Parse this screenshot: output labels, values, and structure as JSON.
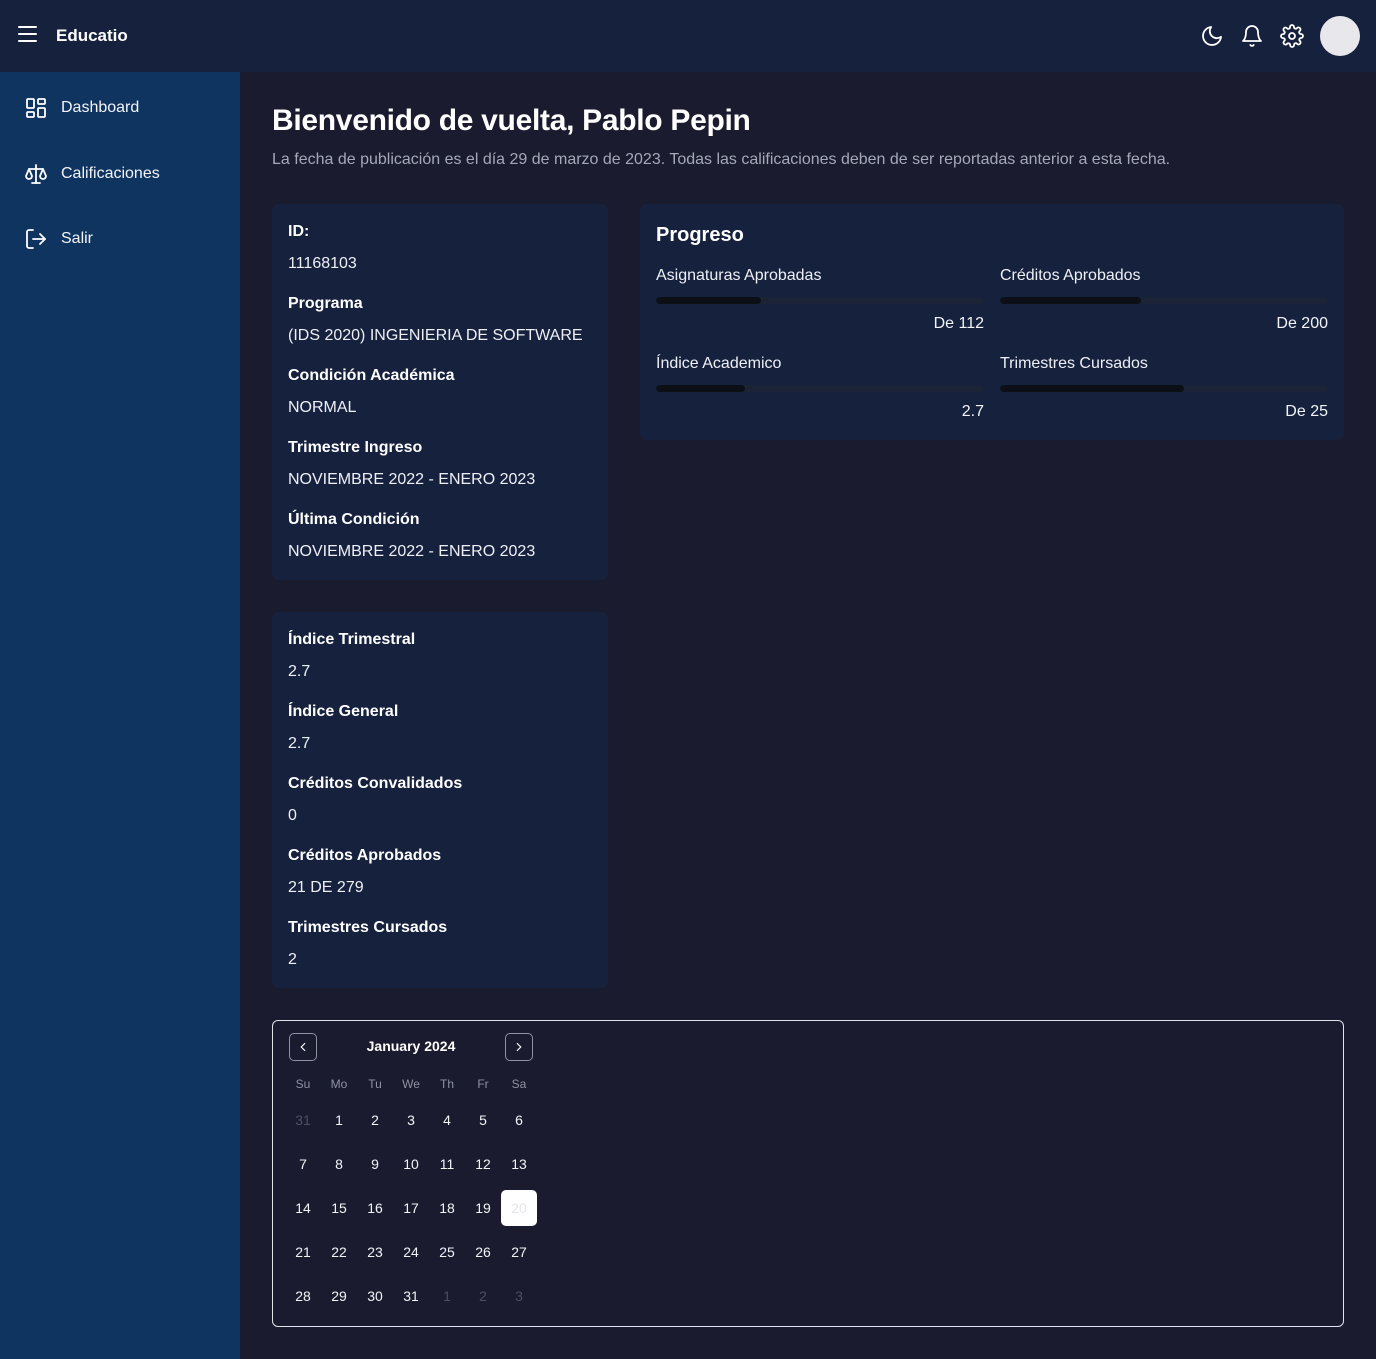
{
  "app": {
    "brand": "Educatio"
  },
  "sidebar": {
    "items": [
      {
        "label": "Dashboard",
        "icon": "dashboard-icon"
      },
      {
        "label": "Calificaciones",
        "icon": "scale-icon"
      },
      {
        "label": "Salir",
        "icon": "logout-icon"
      }
    ]
  },
  "header": {
    "welcome": "Bienvenido de vuelta, Pablo Pepin",
    "subtitle": "La fecha de publicación es el día 29 de marzo de 2023. Todas las calificaciones deben de ser reportadas anterior a esta fecha."
  },
  "student": [
    {
      "label": "ID:",
      "value": "11168103"
    },
    {
      "label": "Programa",
      "value": "(IDS 2020) INGENIERIA DE SOFTWARE"
    },
    {
      "label": "Condición Académica",
      "value": "NORMAL"
    },
    {
      "label": "Trimestre Ingreso",
      "value": "NOVIEMBRE 2022 - ENERO 2023"
    },
    {
      "label": "Última Condición",
      "value": "NOVIEMBRE 2022 - ENERO 2023"
    }
  ],
  "academic": [
    {
      "label": "Índice Trimestral",
      "value": "2.7"
    },
    {
      "label": "Índice General",
      "value": "2.7"
    },
    {
      "label": "Créditos Convalidados",
      "value": "0"
    },
    {
      "label": "Créditos Aprobados",
      "value": "21 DE 279"
    },
    {
      "label": "Trimestres Cursados",
      "value": "2"
    }
  ],
  "progress": {
    "title": "Progreso",
    "items": [
      {
        "label": "Asignaturas Aprobadas",
        "value": "De 112",
        "fill": 0.32
      },
      {
        "label": "Créditos Aprobados",
        "value": "De 200",
        "fill": 0.43
      },
      {
        "label": "Índice Academico",
        "value": "2.7",
        "fill": 0.27
      },
      {
        "label": "Trimestres Cursados",
        "value": "De 25",
        "fill": 0.56
      }
    ]
  },
  "calendar": {
    "title": "January 2024",
    "weekdays": [
      "Su",
      "Mo",
      "Tu",
      "We",
      "Th",
      "Fr",
      "Sa"
    ],
    "weeks": [
      [
        "31",
        "1",
        "2",
        "3",
        "4",
        "5",
        "6"
      ],
      [
        "7",
        "8",
        "9",
        "10",
        "11",
        "12",
        "13"
      ],
      [
        "14",
        "15",
        "16",
        "17",
        "18",
        "19",
        "20"
      ],
      [
        "21",
        "22",
        "23",
        "24",
        "25",
        "26",
        "27"
      ],
      [
        "28",
        "29",
        "30",
        "31",
        "1",
        "2",
        "3"
      ]
    ],
    "selected": "20"
  },
  "colors": {
    "topbar": "#16213e",
    "sidebar": "#0f3460",
    "background": "#1a1b2e",
    "card": "#16213e"
  }
}
